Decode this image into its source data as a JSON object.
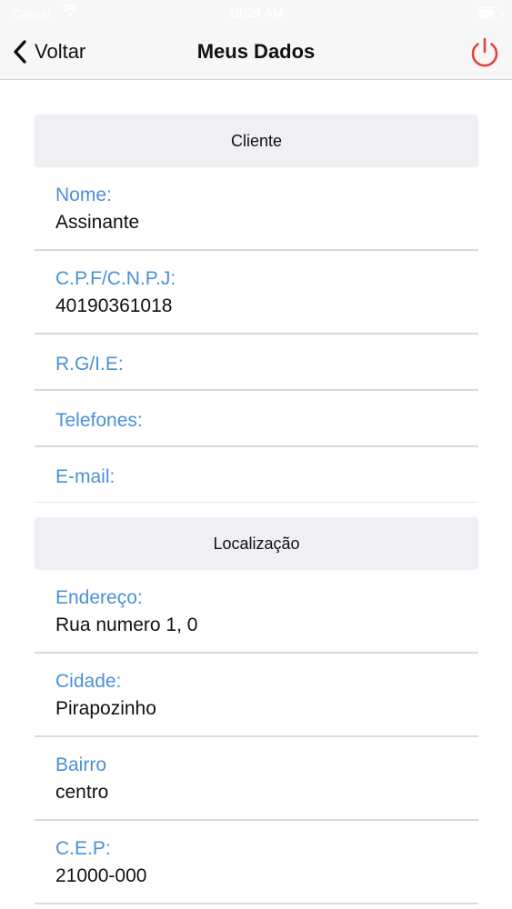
{
  "status_bar": {
    "carrier": "Carrier",
    "wifi_icon": "wifi-icon",
    "time": "10:29 AM",
    "battery_icon": "battery-icon"
  },
  "nav": {
    "back_label": "Voltar",
    "title": "Meus Dados",
    "power_icon": "power-icon",
    "power_color": "#e8403a"
  },
  "sections": {
    "cliente": {
      "title": "Cliente",
      "nome": {
        "label": "Nome:",
        "value": "Assinante"
      },
      "cpf": {
        "label": "C.P.F/C.N.P.J:",
        "value": "40190361018"
      },
      "rg": {
        "label": "R.G/I.E:"
      },
      "telefones": {
        "label": "Telefones:"
      },
      "email": {
        "label": "E-mail:"
      }
    },
    "localizacao": {
      "title": "Localização",
      "endereco": {
        "label": "Endereço:",
        "value": "Rua numero 1, 0"
      },
      "cidade": {
        "label": "Cidade:",
        "value": "Pirapozinho"
      },
      "bairro": {
        "label": "Bairro",
        "value": "centro"
      },
      "cep": {
        "label": "C.E.P:",
        "value": "21000-000"
      }
    }
  },
  "colors": {
    "label_blue": "#4a90d9",
    "section_bg": "#efeff4",
    "nav_bg": "#f7f7f7"
  }
}
